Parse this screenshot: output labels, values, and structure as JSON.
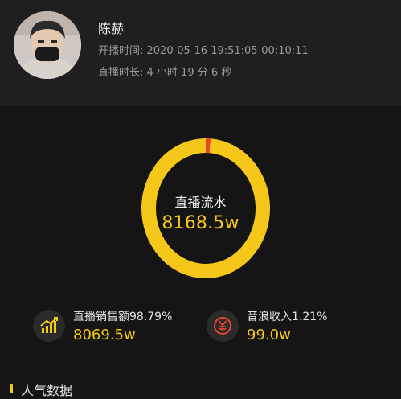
{
  "streamer": {
    "name": "陈赫",
    "start_time": "开播时间: 2020-05-16 19:51:05-00:10:11",
    "duration": "直播时长: 4 小时 19 分 6 秒"
  },
  "summary": {
    "title": "直播流水",
    "total": "8168.5w"
  },
  "breakdown": {
    "sales": {
      "label": "直播销售额98.79%",
      "value": "8069.5w",
      "percent": 98.79,
      "icon": "chart-up-icon"
    },
    "tips": {
      "label": "音浪收入1.21%",
      "value": "99.0w",
      "percent": 1.21,
      "icon": "yen-coin-icon"
    }
  },
  "section": {
    "title": "人气数据"
  },
  "colors": {
    "accent": "#f5c71a",
    "tips_segment": "#e8452c",
    "background": "#151515",
    "header_bg": "#1f1f1f"
  }
}
